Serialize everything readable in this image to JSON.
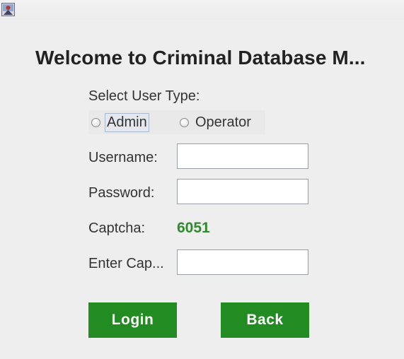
{
  "window": {
    "heading": "Welcome to Criminal Database M..."
  },
  "form": {
    "user_type_label": "Select User Type:",
    "user_types": [
      {
        "label": "Admin",
        "selected": false
      },
      {
        "label": "Operator",
        "selected": false
      }
    ],
    "username_label": "Username:",
    "username_value": "",
    "password_label": "Password:",
    "password_value": "",
    "captcha_label": "Captcha:",
    "captcha_value": "6051",
    "enter_captcha_label": "Enter Cap...",
    "enter_captcha_value": ""
  },
  "buttons": {
    "login_label": "Login",
    "back_label": "Back"
  },
  "colors": {
    "button_bg": "#228b22",
    "captcha_text": "#2e8b2e",
    "background": "#eeeeee"
  },
  "icons": {
    "app_icon": "java-app-icon"
  }
}
